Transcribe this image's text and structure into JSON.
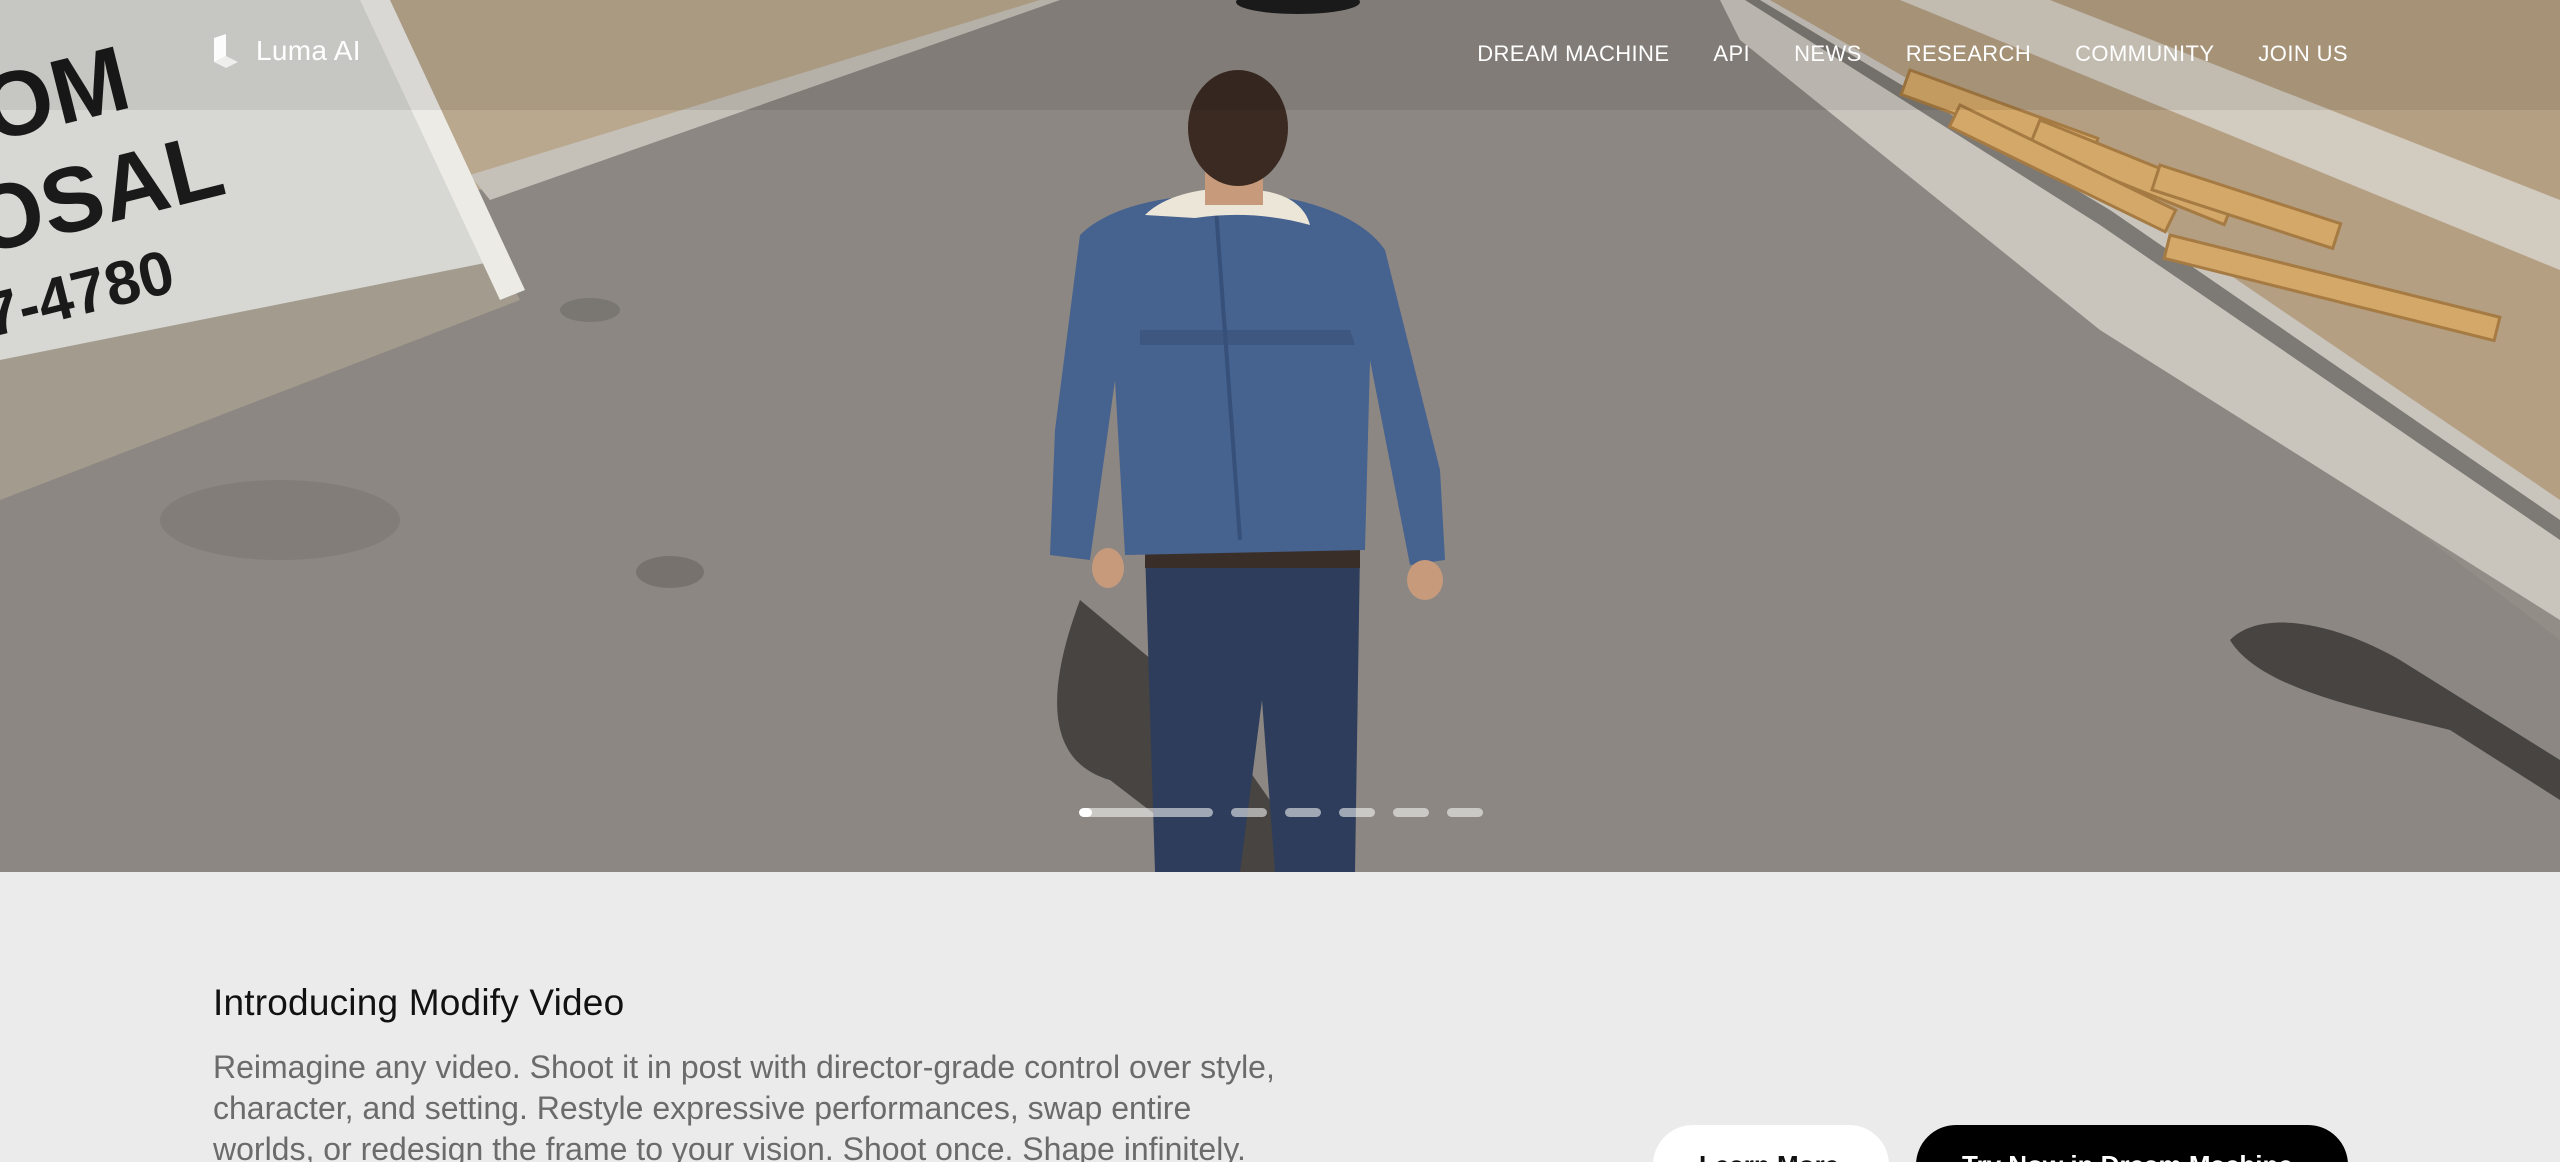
{
  "nav": {
    "logo_text": "Luma AI",
    "items": [
      {
        "label": "DREAM MACHINE"
      },
      {
        "label": "API"
      },
      {
        "label": "NEWS"
      },
      {
        "label": "RESEARCH"
      },
      {
        "label": "COMMUNITY"
      },
      {
        "label": "JOIN US"
      }
    ]
  },
  "hero": {
    "dumpster_text": [
      "OM",
      "OSAL",
      "7-4780"
    ],
    "slides_total": 6,
    "active_slide": 1,
    "active_slide_progress": 0.1
  },
  "content": {
    "headline": "Introducing Modify Video",
    "description": "Reimagine any video. Shoot it in post with director-grade control over style, character, and setting. Restyle expressive performances, swap entire worlds, or redesign the frame to your vision. Shoot once. Shape infinitely.",
    "learn_more_label": "Learn More",
    "try_label": "Try Now in Dream Machine"
  },
  "colors": {
    "page_bg": "#ebebeb",
    "primary_button_bg": "#000000",
    "secondary_button_bg": "#ffffff",
    "nav_text": "#ffffff"
  }
}
